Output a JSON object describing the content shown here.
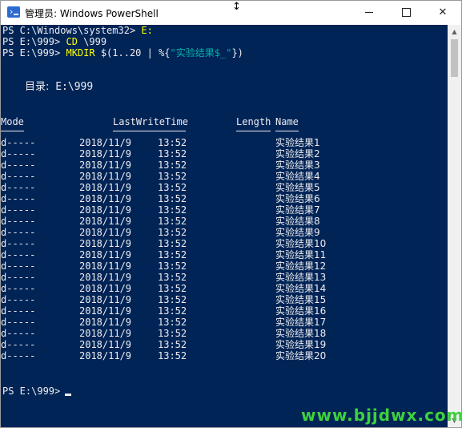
{
  "window": {
    "title": "管理员: Windows PowerShell",
    "app_icon": "powershell-icon",
    "controls": {
      "minimize": "minimize-icon",
      "maximize": "maximize-icon",
      "close": "close-icon",
      "close_glyph": "✕"
    }
  },
  "colors": {
    "console_bg": "#012456",
    "text": "#eeedf0",
    "command": "#ffff00",
    "string": "#00b0b0",
    "watermark": "#3dd13d"
  },
  "console": {
    "line1": {
      "prompt": "PS C:\\Windows\\system32> ",
      "cmd": "E:"
    },
    "line2": {
      "prompt": "PS E:\\999> ",
      "cmd": "CD",
      "arg": " \\999"
    },
    "line3": {
      "prompt": "PS E:\\999> ",
      "cmd": "MKDIR",
      "arg": " $(1..20 | %{",
      "str": "\"实验结果$_\"",
      "tail": "})"
    },
    "directory_label": "目录:",
    "directory_path": " E:\\999",
    "headers": {
      "mode": "Mode",
      "lastwrite": "LastWriteTime",
      "length": "Length",
      "name": "Name"
    },
    "rows": [
      {
        "mode": "d-----",
        "date": "2018/11/9",
        "time": "13:52",
        "name": "实验结果1"
      },
      {
        "mode": "d-----",
        "date": "2018/11/9",
        "time": "13:52",
        "name": "实验结果2"
      },
      {
        "mode": "d-----",
        "date": "2018/11/9",
        "time": "13:52",
        "name": "实验结果3"
      },
      {
        "mode": "d-----",
        "date": "2018/11/9",
        "time": "13:52",
        "name": "实验结果4"
      },
      {
        "mode": "d-----",
        "date": "2018/11/9",
        "time": "13:52",
        "name": "实验结果5"
      },
      {
        "mode": "d-----",
        "date": "2018/11/9",
        "time": "13:52",
        "name": "实验结果6"
      },
      {
        "mode": "d-----",
        "date": "2018/11/9",
        "time": "13:52",
        "name": "实验结果7"
      },
      {
        "mode": "d-----",
        "date": "2018/11/9",
        "time": "13:52",
        "name": "实验结果8"
      },
      {
        "mode": "d-----",
        "date": "2018/11/9",
        "time": "13:52",
        "name": "实验结果9"
      },
      {
        "mode": "d-----",
        "date": "2018/11/9",
        "time": "13:52",
        "name": "实验结果10"
      },
      {
        "mode": "d-----",
        "date": "2018/11/9",
        "time": "13:52",
        "name": "实验结果11"
      },
      {
        "mode": "d-----",
        "date": "2018/11/9",
        "time": "13:52",
        "name": "实验结果12"
      },
      {
        "mode": "d-----",
        "date": "2018/11/9",
        "time": "13:52",
        "name": "实验结果13"
      },
      {
        "mode": "d-----",
        "date": "2018/11/9",
        "time": "13:52",
        "name": "实验结果14"
      },
      {
        "mode": "d-----",
        "date": "2018/11/9",
        "time": "13:52",
        "name": "实验结果15"
      },
      {
        "mode": "d-----",
        "date": "2018/11/9",
        "time": "13:52",
        "name": "实验结果16"
      },
      {
        "mode": "d-----",
        "date": "2018/11/9",
        "time": "13:52",
        "name": "实验结果17"
      },
      {
        "mode": "d-----",
        "date": "2018/11/9",
        "time": "13:52",
        "name": "实验结果18"
      },
      {
        "mode": "d-----",
        "date": "2018/11/9",
        "time": "13:52",
        "name": "实验结果19"
      },
      {
        "mode": "d-----",
        "date": "2018/11/9",
        "time": "13:52",
        "name": "实验结果20"
      }
    ],
    "final_prompt": "PS E:\\999>"
  },
  "watermark": "www.bjjdwx.com"
}
